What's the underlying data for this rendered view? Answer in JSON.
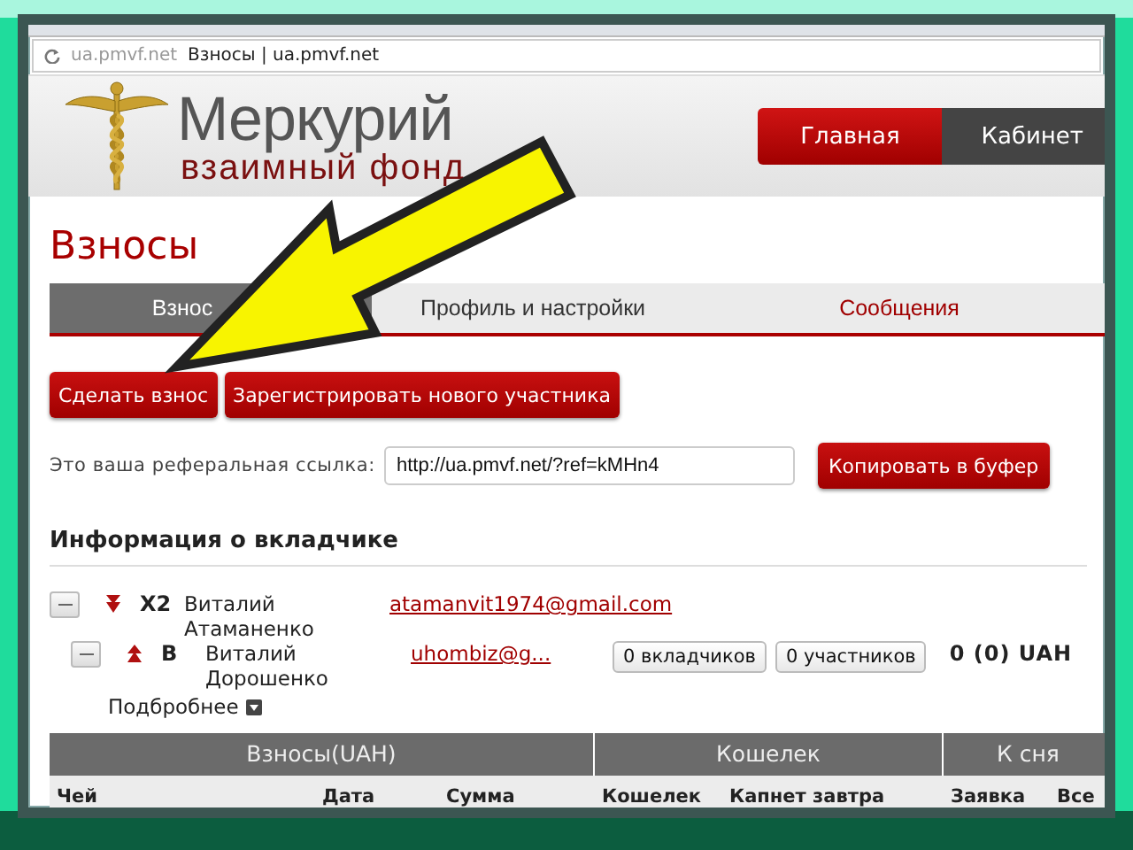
{
  "browser": {
    "address": "ua.pmvf.net",
    "page_title": "Взносы | ua.pmvf.net"
  },
  "header": {
    "logo_title": "Меркурий",
    "logo_subtitle": "взаимный фонд",
    "nav": [
      {
        "label": "Главная",
        "selected": true
      },
      {
        "label": "Кабинет",
        "selected": false
      }
    ]
  },
  "page_title": "Взносы",
  "tabs": [
    {
      "label": "Взнос",
      "selected": true,
      "highlighted": false
    },
    {
      "label": "Профиль и настройки",
      "selected": false,
      "highlighted": false
    },
    {
      "label": "Сообщения",
      "selected": false,
      "highlighted": true
    }
  ],
  "actions": [
    "Сделать взнос",
    "Зарегистрировать нового участника"
  ],
  "referral": {
    "label": "Это ваша реферальная ссылка:",
    "value": "http://ua.pmvf.net/?ref=kMHn4",
    "button": "Копировать в буфер"
  },
  "section_title": "Информация о вкладчике",
  "tree": [
    {
      "expanded": true,
      "kind": "down",
      "rank": "X2",
      "name": "Виталий Атаманенко",
      "email": "atamanvit1974@gmail.com",
      "children": [
        {
          "expanded": true,
          "kind": "up",
          "rank": "B",
          "name": "Виталий Дорошенко",
          "email": "uhombiz@g...",
          "buttons": [
            "0 вкладчиков",
            "0 участников"
          ],
          "total": "0 (0) UAH"
        }
      ]
    }
  ],
  "details_link": "Подбробнее",
  "table": {
    "groups": [
      "Взносы(UAH)",
      "Кошелек",
      "К сня"
    ],
    "columns": [
      "Чей",
      "Дата",
      "Сумма",
      "Кошелек",
      "Капнет завтра",
      "Заявка",
      "Все"
    ]
  }
}
